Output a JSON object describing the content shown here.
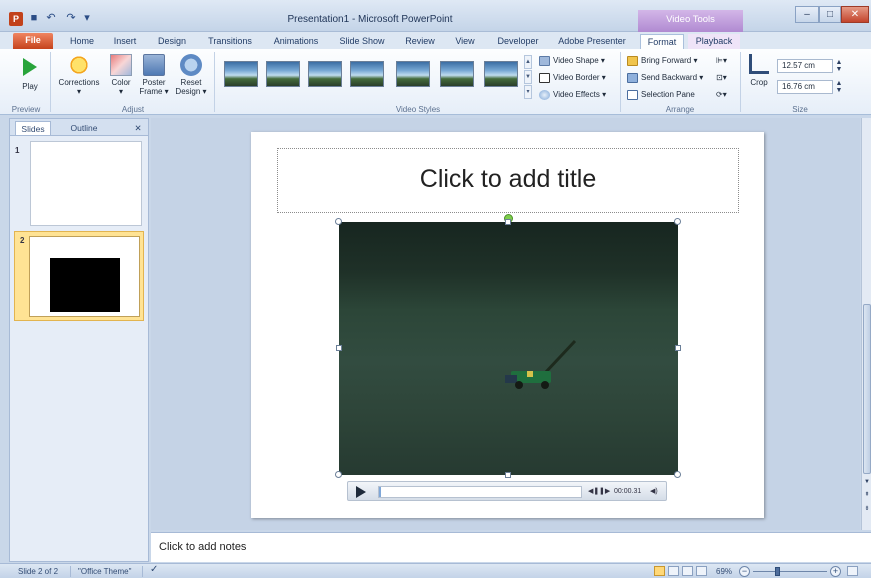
{
  "window": {
    "title": "Presentation1 - Microsoft PowerPoint",
    "contextual_group": "Video Tools",
    "minimize": "–",
    "maximize": "□",
    "close": "✕"
  },
  "qat": {
    "save": "■",
    "undo": "↶",
    "redo": "↷",
    "customize": "▾"
  },
  "tabs": [
    {
      "label": "File"
    },
    {
      "label": "Home"
    },
    {
      "label": "Insert"
    },
    {
      "label": "Design"
    },
    {
      "label": "Transitions"
    },
    {
      "label": "Animations"
    },
    {
      "label": "Slide Show"
    },
    {
      "label": "Review"
    },
    {
      "label": "View"
    },
    {
      "label": "Developer"
    },
    {
      "label": "Adobe Presenter"
    },
    {
      "label": "Format"
    },
    {
      "label": "Playback"
    }
  ],
  "active_tab": "Format",
  "ribbon": {
    "groups": {
      "preview": "Preview",
      "adjust": "Adjust",
      "video_styles": "Video Styles",
      "arrange": "Arrange",
      "size": "Size"
    },
    "preview": {
      "play": "Play"
    },
    "adjust": {
      "corrections": "Corrections",
      "color": "Color",
      "poster_frame_1": "Poster",
      "poster_frame_2": "Frame ▾",
      "reset_design_1": "Reset",
      "reset_design_2": "Design ▾"
    },
    "video_styles": {
      "video_shape": "Video Shape ▾",
      "video_border": "Video Border ▾",
      "video_effects": "Video Effects ▾"
    },
    "arrange": {
      "bring_forward": "Bring Forward ▾",
      "send_backward": "Send Backward ▾",
      "selection_pane": "Selection Pane"
    },
    "size": {
      "crop": "Crop",
      "height": "12.57 cm",
      "width": "16.76 cm"
    }
  },
  "slides_pane": {
    "tab_slides": "Slides",
    "tab_outline": "Outline",
    "close": "✕",
    "thumbnails": [
      {
        "number": "1"
      },
      {
        "number": "2"
      }
    ]
  },
  "slide": {
    "title_placeholder": "Click to add title",
    "media_time": "00:00.31"
  },
  "notes": {
    "placeholder": "Click to add notes"
  },
  "status": {
    "slide_position": "Slide 2 of 2",
    "theme": "\"Office Theme\"",
    "zoom": "69%"
  },
  "colors": {
    "file_tab": "#c5431d",
    "contextual": "#b08ad1",
    "selected_thumb": "#ffe394",
    "play_green": "#28a43b"
  }
}
